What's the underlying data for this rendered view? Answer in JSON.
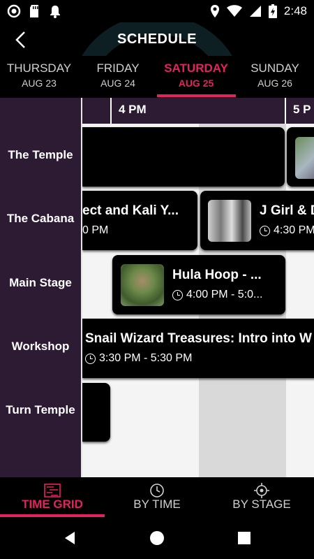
{
  "status": {
    "time": "2:48"
  },
  "header": {
    "title": "SCHEDULE"
  },
  "days": [
    {
      "day": "THURSDAY",
      "date": "AUG 23",
      "active": false
    },
    {
      "day": "FRIDAY",
      "date": "AUG 24",
      "active": false
    },
    {
      "day": "SATURDAY",
      "date": "AUG 25",
      "active": true
    },
    {
      "day": "SUNDAY",
      "date": "AUG 26",
      "active": false
    }
  ],
  "timeline": {
    "labels": [
      "4 PM",
      "5 P"
    ]
  },
  "stages": [
    "The Temple",
    "The Cabana",
    "Main Stage",
    "Workshop",
    "Turn Temple"
  ],
  "events": [
    {
      "stage": "The Cabana",
      "title": "ect and Kali Y...",
      "time": "0 PM"
    },
    {
      "stage": "The Cabana",
      "title": "J Girl & D",
      "time": "4:30 PM"
    },
    {
      "stage": "Main Stage",
      "title": "Hula Hoop - ...",
      "time": "4:00 PM - 5:0..."
    },
    {
      "stage": "Workshop",
      "title": "Snail Wizard Treasures: Intro into W",
      "time": "3:30 PM - 5:30 PM"
    }
  ],
  "bottom_nav": [
    {
      "label": "TIME GRID",
      "icon": "time-grid-icon",
      "active": true
    },
    {
      "label": "BY TIME",
      "icon": "clock-icon",
      "active": false
    },
    {
      "label": "BY STAGE",
      "icon": "target-icon",
      "active": false
    }
  ],
  "colors": {
    "accent": "#e5215f",
    "stage_bg": "#2d1b33"
  }
}
